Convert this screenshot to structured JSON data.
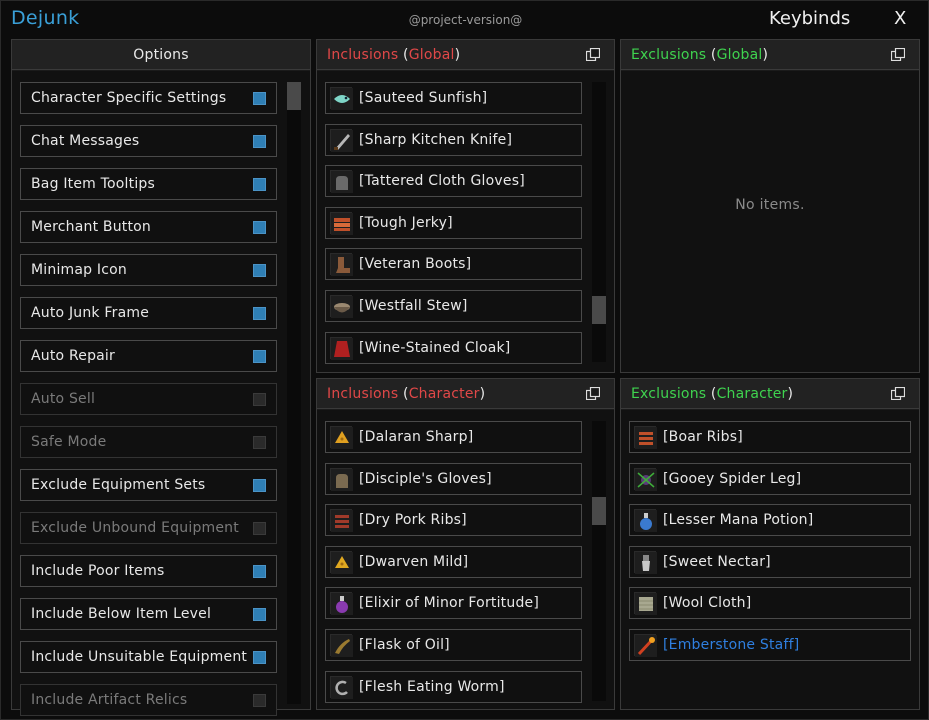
{
  "app": {
    "title": "Dejunk",
    "version": "@project-version@",
    "keybinds_label": "Keybinds",
    "close_label": "X"
  },
  "options": {
    "title": "Options",
    "items": [
      {
        "label": "Character Specific Settings",
        "enabled": true,
        "checked": true
      },
      {
        "label": "Chat Messages",
        "enabled": true,
        "checked": true
      },
      {
        "label": "Bag Item Tooltips",
        "enabled": true,
        "checked": true
      },
      {
        "label": "Merchant Button",
        "enabled": true,
        "checked": true
      },
      {
        "label": "Minimap Icon",
        "enabled": true,
        "checked": true
      },
      {
        "label": "Auto Junk Frame",
        "enabled": true,
        "checked": true
      },
      {
        "label": "Auto Repair",
        "enabled": true,
        "checked": true
      },
      {
        "label": "Auto Sell",
        "enabled": false,
        "checked": false
      },
      {
        "label": "Safe Mode",
        "enabled": false,
        "checked": false
      },
      {
        "label": "Exclude Equipment Sets",
        "enabled": true,
        "checked": true
      },
      {
        "label": "Exclude Unbound Equipment",
        "enabled": false,
        "checked": false
      },
      {
        "label": "Include Poor Items",
        "enabled": true,
        "checked": true
      },
      {
        "label": "Include Below Item Level",
        "enabled": true,
        "checked": true
      },
      {
        "label": "Include Unsuitable Equipment",
        "enabled": true,
        "checked": true
      },
      {
        "label": "Include Artifact Relics",
        "enabled": false,
        "checked": false
      }
    ]
  },
  "inclusions_global": {
    "title_main": "Inclusions",
    "title_scope": "Global",
    "items": [
      {
        "label": "[Sauteed Sunfish]",
        "icon": "fish-icon",
        "color": "#7fd6c8"
      },
      {
        "label": "[Sharp Kitchen Knife]",
        "icon": "knife-icon",
        "color": "#b8b8b8"
      },
      {
        "label": "[Tattered Cloth Gloves]",
        "icon": "gloves-icon",
        "color": "#6a6a6a"
      },
      {
        "label": "[Tough Jerky]",
        "icon": "jerky-icon",
        "color": "#c0502a"
      },
      {
        "label": "[Veteran Boots]",
        "icon": "boots-icon",
        "color": "#8a5a3a"
      },
      {
        "label": "[Westfall Stew]",
        "icon": "stew-icon",
        "color": "#9a8870"
      },
      {
        "label": "[Wine-Stained Cloak]",
        "icon": "cloak-icon",
        "color": "#b02020"
      }
    ]
  },
  "exclusions_global": {
    "title_main": "Exclusions",
    "title_scope": "Global",
    "empty_text": "No items."
  },
  "inclusions_character": {
    "title_main": "Inclusions",
    "title_scope": "Character",
    "items": [
      {
        "label": "[Dalaran Sharp]",
        "icon": "cheese-icon",
        "color": "#e0a020"
      },
      {
        "label": "[Disciple's Gloves]",
        "icon": "gloves-icon",
        "color": "#7a6a50"
      },
      {
        "label": "[Dry Pork Ribs]",
        "icon": "ribs-icon",
        "color": "#a03a2a"
      },
      {
        "label": "[Dwarven Mild]",
        "icon": "cheese-icon",
        "color": "#e0a820"
      },
      {
        "label": "[Elixir of Minor Fortitude]",
        "icon": "potion-icon",
        "color": "#8a3ab0"
      },
      {
        "label": "[Flask of Oil]",
        "icon": "flask-icon",
        "color": "#9a7a30"
      },
      {
        "label": "[Flesh Eating Worm]",
        "icon": "worm-icon",
        "color": "#b0b0b0"
      }
    ]
  },
  "exclusions_character": {
    "title_main": "Exclusions",
    "title_scope": "Character",
    "items": [
      {
        "label": "[Boar Ribs]",
        "icon": "ribs-icon",
        "color": "#c0502a",
        "quality": "common"
      },
      {
        "label": "[Gooey Spider Leg]",
        "icon": "spider-leg-icon",
        "color": "#5a3a7a",
        "quality": "common"
      },
      {
        "label": "[Lesser Mana Potion]",
        "icon": "potion-icon",
        "color": "#3a7ad0",
        "quality": "common"
      },
      {
        "label": "[Sweet Nectar]",
        "icon": "nectar-icon",
        "color": "#c8c8c8",
        "quality": "common"
      },
      {
        "label": "[Wool Cloth]",
        "icon": "cloth-icon",
        "color": "#a8a890",
        "quality": "common"
      },
      {
        "label": "[Emberstone Staff]",
        "icon": "staff-icon",
        "color": "#e05020",
        "quality": "rare"
      }
    ]
  },
  "scroll": {
    "options_position": 0.0,
    "inclusions_global_position": 0.85,
    "inclusions_character_position": 0.3
  }
}
